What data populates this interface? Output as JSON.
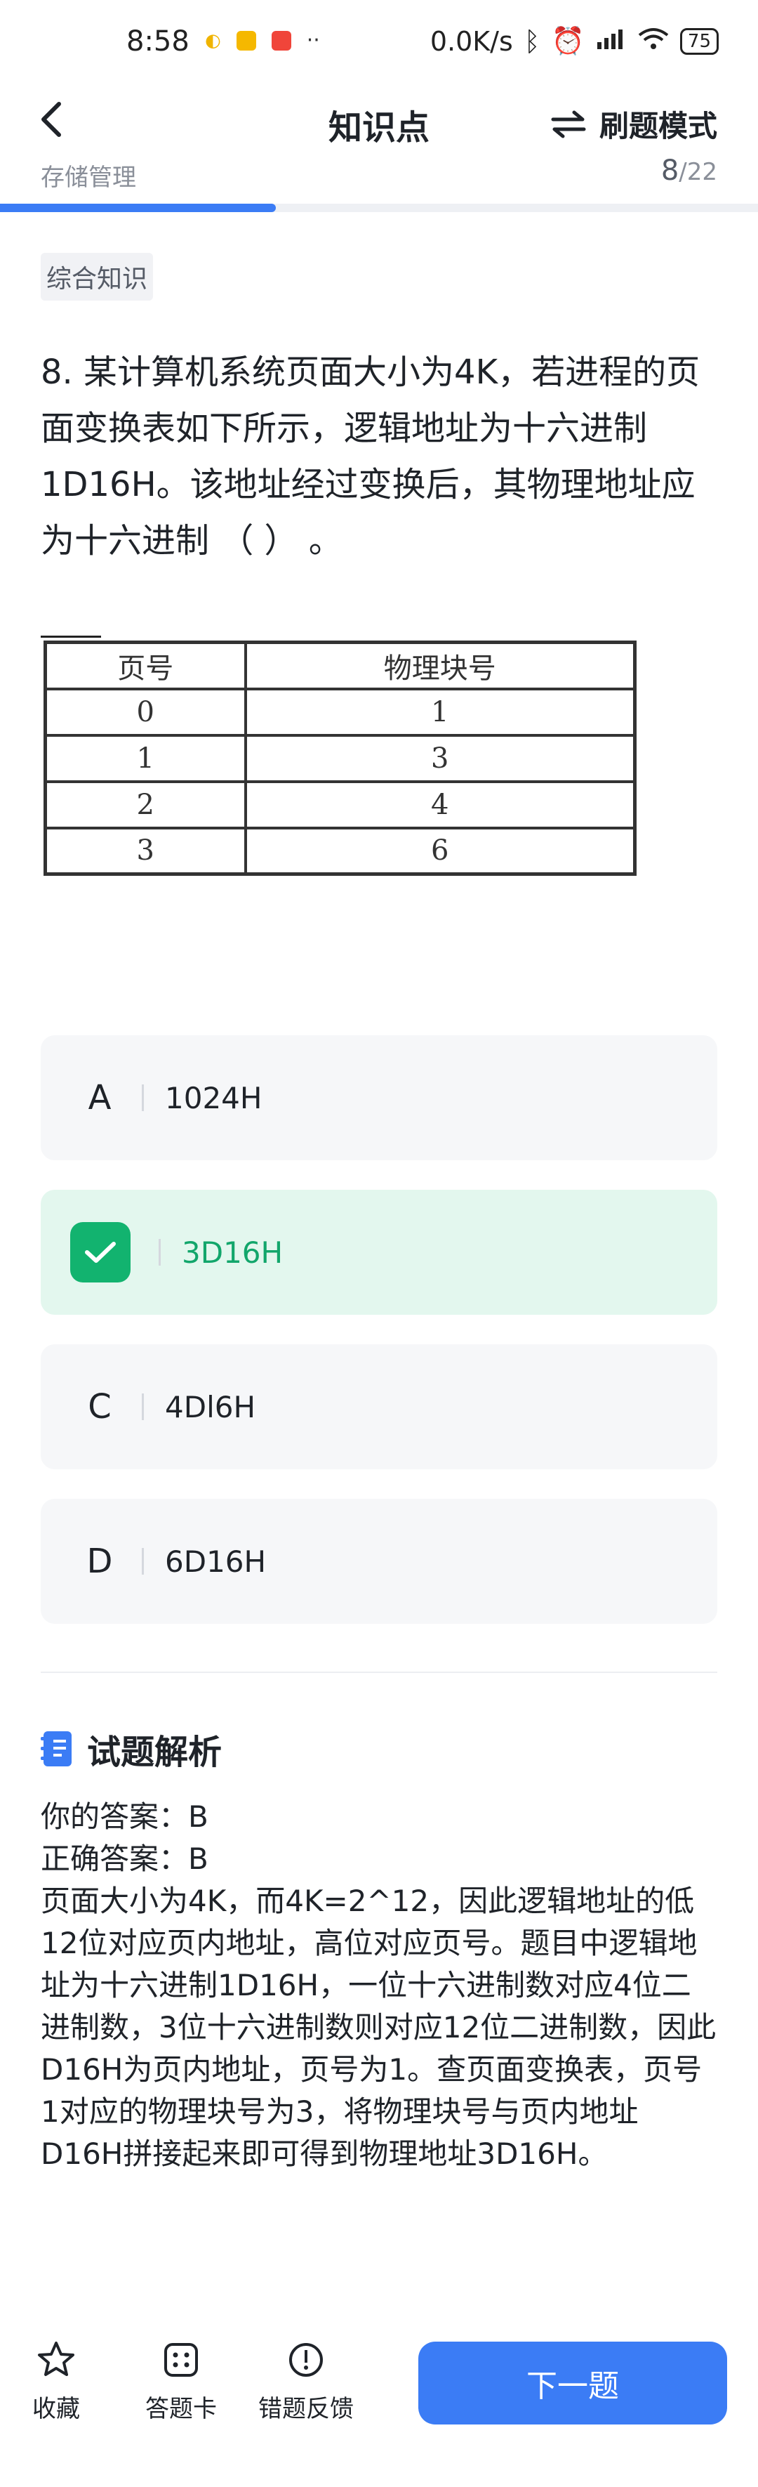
{
  "status_bar": {
    "time": "8:58",
    "network_speed": "0.0K/s",
    "battery": "75",
    "icons": [
      "bluetooth-icon",
      "alarm-icon",
      "signal-icon",
      "wifi-icon",
      "battery-icon"
    ]
  },
  "nav": {
    "title": "知识点",
    "mode_label": "刷题模式"
  },
  "progress": {
    "category": "存储管理",
    "current": "8",
    "total": "/22",
    "fraction": 0.364
  },
  "question": {
    "tag": "综合知识",
    "text": "8. 某计算机系统页面大小为4K，若进程的页面变换表如下所示，逻辑地址为十六进制1D16H。该地址经过变换后，其物理地址应为十六进制 （ ） 。",
    "table": {
      "headers": [
        "页号",
        "物理块号"
      ],
      "rows": [
        [
          "0",
          "1"
        ],
        [
          "1",
          "3"
        ],
        [
          "2",
          "4"
        ],
        [
          "3",
          "6"
        ]
      ]
    }
  },
  "options": [
    {
      "letter": "A",
      "text": "1024H",
      "selected": false
    },
    {
      "letter": "B",
      "text": "3D16H",
      "selected": true
    },
    {
      "letter": "C",
      "text": "4Dl6H",
      "selected": false
    },
    {
      "letter": "D",
      "text": "6D16H",
      "selected": false
    }
  ],
  "analysis": {
    "title": "试题解析",
    "your_answer": "你的答案：B",
    "correct_answer": "正确答案：B",
    "explanation": "页面大小为4K，而4K=2^12，因此逻辑地址的低12位对应页内地址，高位对应页号。题目中逻辑地址为十六进制1D16H，一位十六进制数对应4位二进制数，3位十六进制数则对应12位二进制数，因此D16H为页内地址，页号为1。查页面变换表，页号1对应的物理块号为3，将物理块号与页内地址D16H拼接起来即可得到物理地址3D16H。"
  },
  "bottom_bar": {
    "favorite_label": "收藏",
    "answer_card_label": "答题卡",
    "feedback_label": "错题反馈",
    "next_label": "下一题"
  },
  "colors": {
    "accent": "#3b7cf5",
    "correct": "#12b36f",
    "correct_bg": "#e3f7ee"
  }
}
